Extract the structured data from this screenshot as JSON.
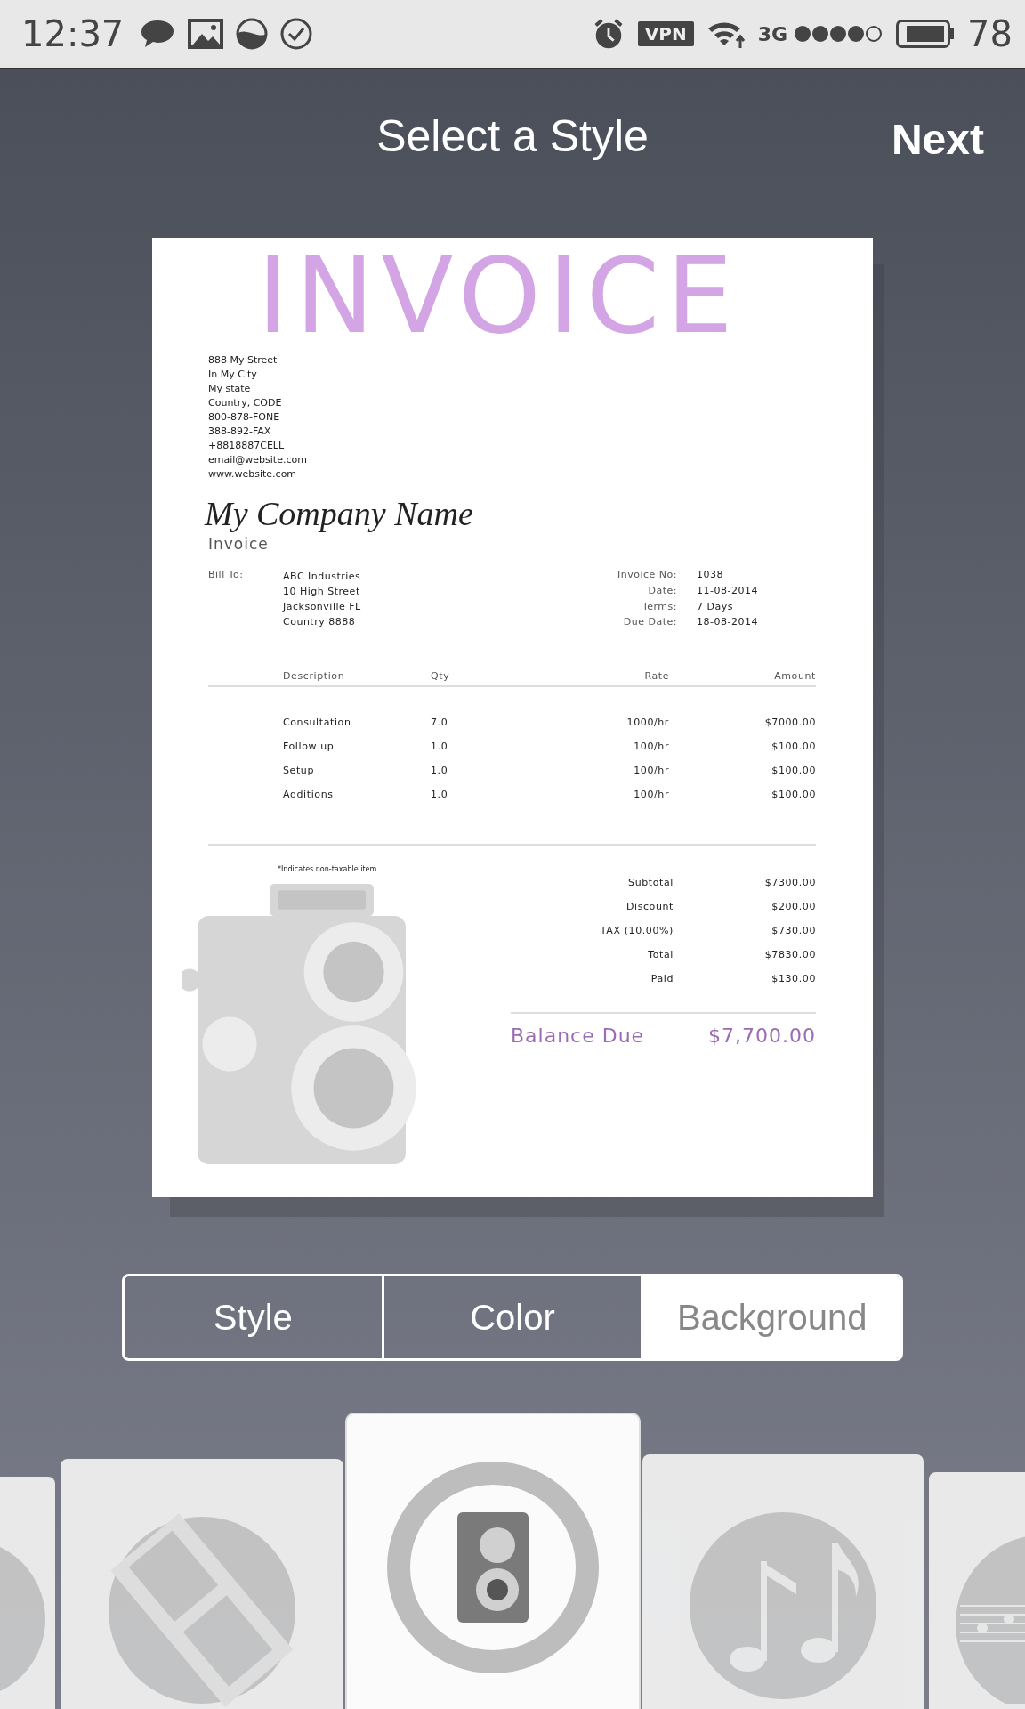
{
  "status_bar": {
    "time": "12:37",
    "vpn": "VPN",
    "network": "3G",
    "battery": "78"
  },
  "header": {
    "title": "Select a Style",
    "next": "Next"
  },
  "invoice": {
    "heading": "INVOICE",
    "sender_lines": [
      "888 My Street",
      "In My City",
      "My state",
      "Country, CODE",
      "800-878-FONE",
      "388-892-FAX",
      "+8818887CELL",
      "email@website.com",
      "www.website.com"
    ],
    "company": "My Company Name",
    "subtitle": "Invoice",
    "bill_to_label": "Bill To:",
    "bill_to_lines": [
      "ABC Industries",
      "10 High Street",
      "Jacksonville FL",
      "Country 8888"
    ],
    "meta": [
      {
        "label": "Invoice No:",
        "value": "1038"
      },
      {
        "label": "Date:",
        "value": "11-08-2014"
      },
      {
        "label": "Terms:",
        "value": "7 Days"
      },
      {
        "label": "Due Date:",
        "value": "18-08-2014"
      }
    ],
    "columns": [
      "Description",
      "Qty",
      "Rate",
      "Amount"
    ],
    "items": [
      [
        "Consultation",
        "7.0",
        "1000/hr",
        "$7000.00"
      ],
      [
        "Follow up",
        "1.0",
        "100/hr",
        "$100.00"
      ],
      [
        "Setup",
        "1.0",
        "100/hr",
        "$100.00"
      ],
      [
        "Additions",
        "1.0",
        "100/hr",
        "$100.00"
      ]
    ],
    "note": "*Indicates non-taxable item",
    "totals": [
      {
        "label": "Subtotal",
        "value": "$7300.00"
      },
      {
        "label": "Discount",
        "value": "$200.00"
      },
      {
        "label": "TAX (10.00%)",
        "value": "$730.00"
      },
      {
        "label": "Total",
        "value": "$7830.00"
      },
      {
        "label": "Paid",
        "value": "$130.00"
      }
    ],
    "balance": {
      "label": "Balance Due",
      "value": "$7,700.00"
    }
  },
  "tabs": [
    {
      "label": "Style",
      "selected": false
    },
    {
      "label": "Color",
      "selected": false
    },
    {
      "label": "Background",
      "selected": true
    }
  ],
  "backgrounds": [
    {
      "kind": "disc",
      "selected": false
    },
    {
      "kind": "film",
      "selected": false
    },
    {
      "kind": "camera",
      "selected": true
    },
    {
      "kind": "music",
      "selected": false
    },
    {
      "kind": "sheet-music",
      "selected": false
    }
  ]
}
